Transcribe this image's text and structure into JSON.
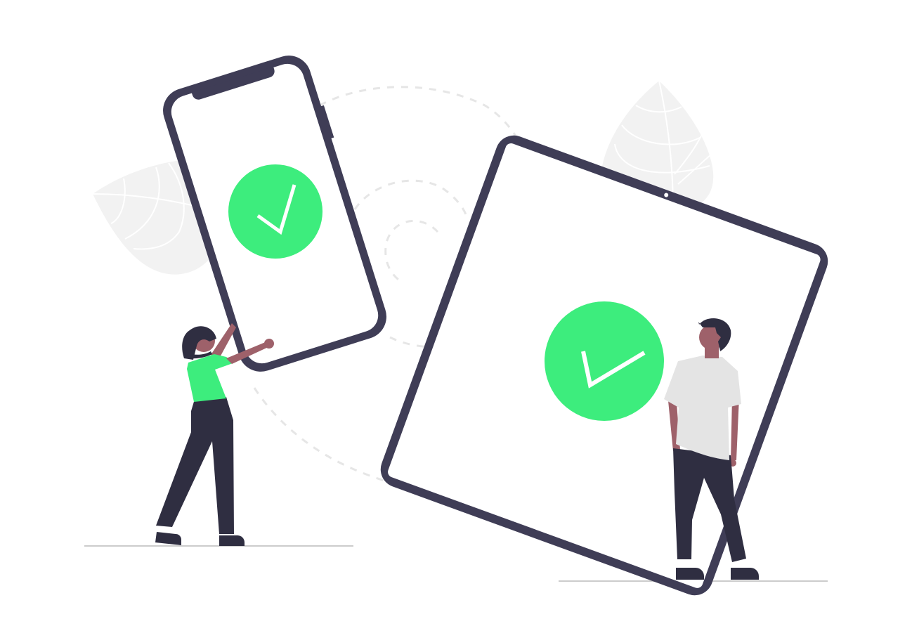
{
  "illustration": {
    "subject": "two-devices-with-checkmarks",
    "colors": {
      "device_frame": "#3f3d56",
      "screen": "#ffffff",
      "check_circle": "#3ded7d",
      "check_mark": "#ffffff",
      "leaf": "#f2f2f2",
      "leaf_vein": "#ffffff",
      "dashed_path": "#e6e6e6",
      "ground": "#cccccc",
      "skin": "#9e616a",
      "hair": "#2f2e41",
      "pants": "#2f2e41",
      "shoes": "#2f2e41",
      "shirt_woman": "#3ded7d",
      "shirt_man": "#e4e4e4"
    },
    "icons": [
      "leaf-icon",
      "phone-icon",
      "tablet-icon",
      "check-circle-icon"
    ]
  }
}
